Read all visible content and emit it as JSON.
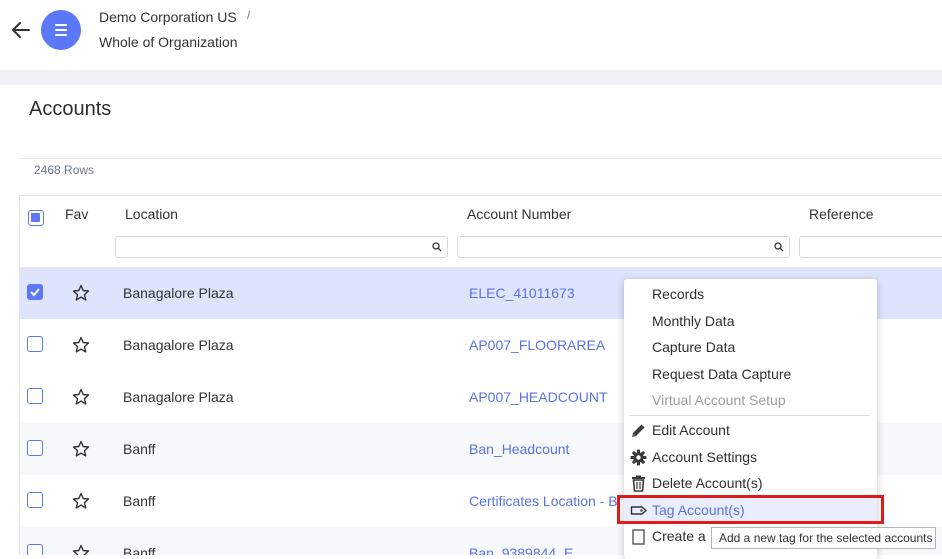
{
  "header": {
    "organization": "Demo Corporation US",
    "separator": "/",
    "scope": "Whole of Organization"
  },
  "page": {
    "title": "Accounts",
    "row_count": "2468 Rows"
  },
  "grid": {
    "columns": [
      "Fav",
      "Location",
      "Account Number",
      "Reference"
    ],
    "rows": [
      {
        "location": "Banagalore Plaza",
        "account": "ELEC_41011673",
        "selected": true
      },
      {
        "location": "Banagalore Plaza",
        "account": "AP007_FLOORAREA",
        "selected": false
      },
      {
        "location": "Banagalore Plaza",
        "account": "AP007_HEADCOUNT",
        "selected": false
      },
      {
        "location": "Banff",
        "account": "Ban_Headcount",
        "selected": false
      },
      {
        "location": "Banff",
        "account": "Certificates Location - B",
        "selected": false
      },
      {
        "location": "Banff",
        "account": "Ban_9389844_E",
        "selected": false
      }
    ]
  },
  "context_menu": {
    "items": [
      {
        "label": "Records",
        "icon": "",
        "disabled": false
      },
      {
        "label": "Monthly Data",
        "icon": "",
        "disabled": false
      },
      {
        "label": "Capture Data",
        "icon": "",
        "disabled": false
      },
      {
        "label": "Request Data Capture",
        "icon": "",
        "disabled": false
      },
      {
        "label": "Virtual Account Setup",
        "icon": "",
        "disabled": true
      },
      {
        "label": "Edit Account",
        "icon": "pencil-icon",
        "disabled": false
      },
      {
        "label": "Account Settings",
        "icon": "gear-icon",
        "disabled": false
      },
      {
        "label": "Delete Account(s)",
        "icon": "trash-icon",
        "disabled": false
      },
      {
        "label": "Tag Account(s)",
        "icon": "tag-icon",
        "disabled": false
      },
      {
        "label": "Create a",
        "icon": "copy-icon",
        "disabled": false
      }
    ]
  },
  "tooltip": "Add a new tag for the selected accounts",
  "colors": {
    "accent": "#5b78f6",
    "link": "#5a73e6",
    "selected_row": "#dde4fb",
    "highlight_box": "#e01b1b"
  }
}
